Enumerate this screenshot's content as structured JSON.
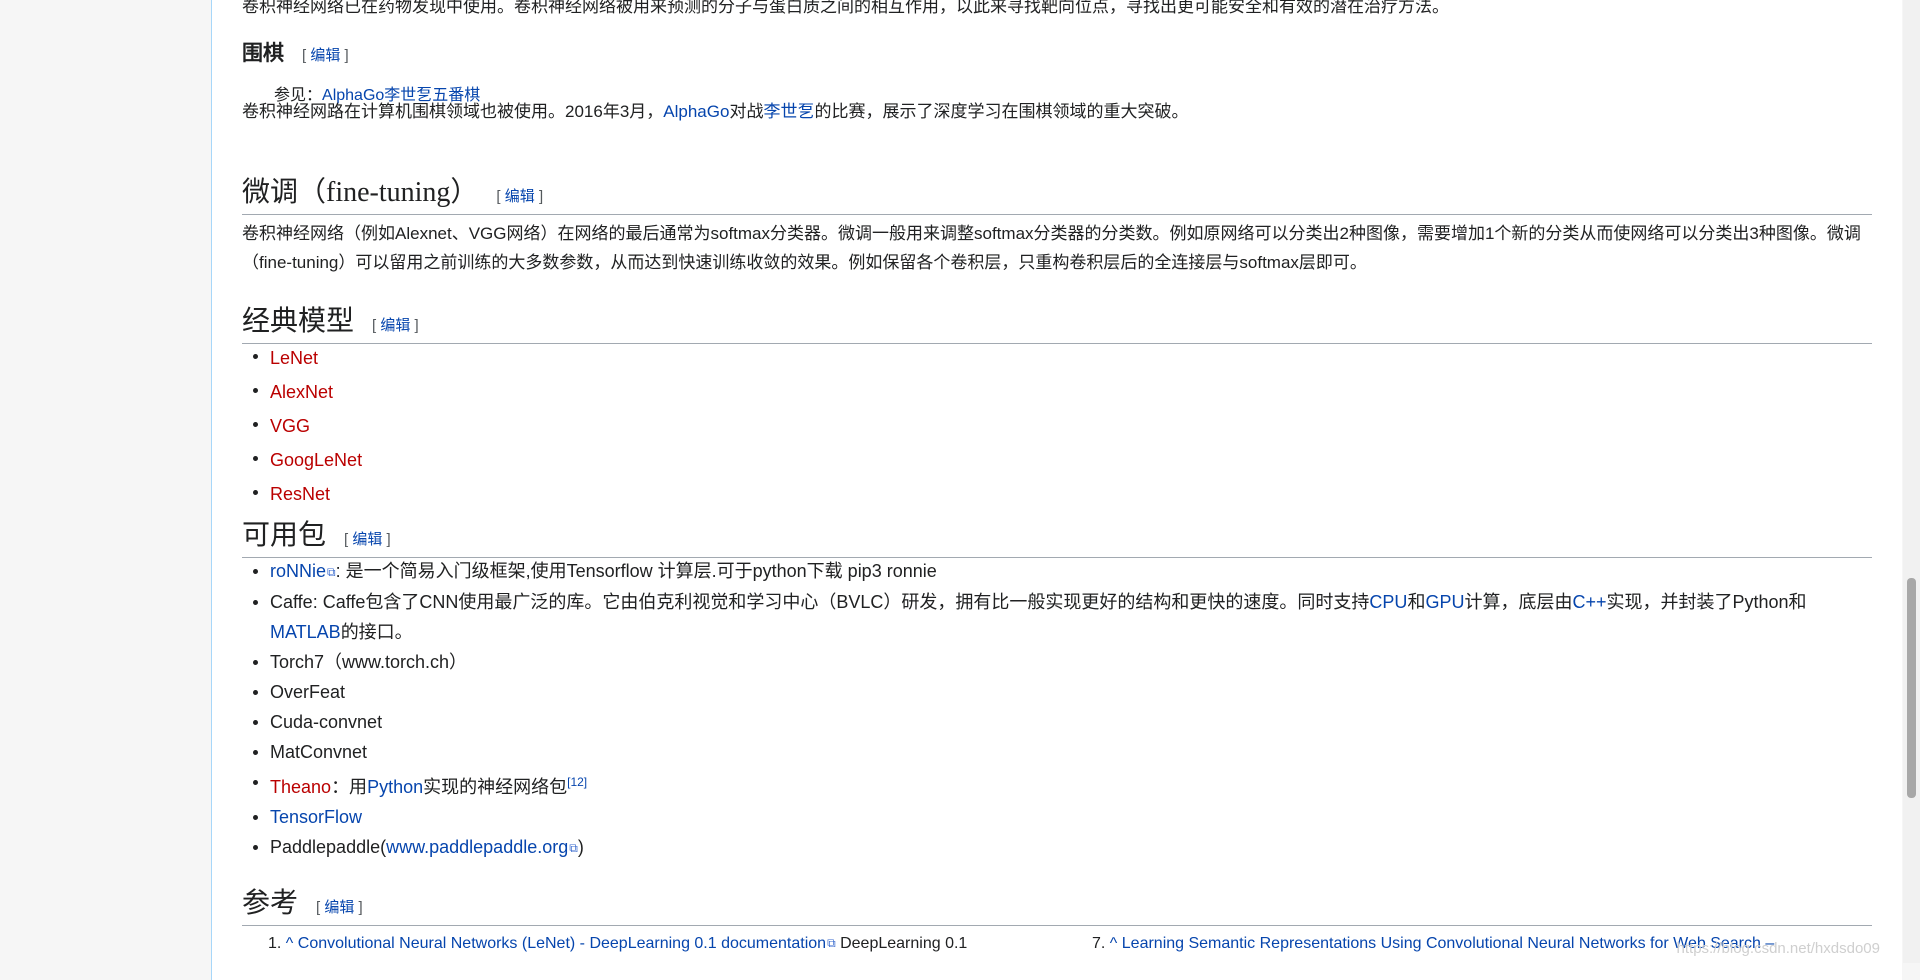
{
  "clipped_text": "卷积神经网络已在药物发现中使用。卷积神经网络被用来预测的分子与蛋白质之间的相互作用，以此来寻找靶向位点，寻找出更可能安全和有效的潜在治疗方法。",
  "edit_label": "编辑",
  "go_section": {
    "heading": "围棋",
    "hatnote_prefix": "参见：",
    "hatnote_link": "AlphaGo李世乭五番棋",
    "para": {
      "t1": "卷积神经网路在计算机围棋领域也被使用。2016年3月，",
      "link1": "AlphaGo",
      "t2": "对战",
      "link2": "李世乭",
      "t3": "的比赛，展示了深度学习在围棋领域的重大突破。"
    }
  },
  "finetune_section": {
    "heading": "微调（fine-tuning）",
    "para": "卷积神经网络（例如Alexnet、VGG网络）在网络的最后通常为softmax分类器。微调一般用来调整softmax分类器的分类数。例如原网络可以分类出2种图像，需要增加1个新的分类从而使网络可以分类出3种图像。微调（fine-tuning）可以留用之前训练的大多数参数，从而达到快速训练收敛的效果。例如保留各个卷积层，只重构卷积层后的全连接层与softmax层即可。"
  },
  "models_section": {
    "heading": "经典模型",
    "items": [
      "LeNet",
      "AlexNet",
      "VGG",
      "GoogLeNet",
      "ResNet"
    ]
  },
  "packages_section": {
    "heading": "可用包",
    "ronnie": {
      "link": "roNNie",
      "text": ": 是一个简易入门级框架,使用Tensorflow 计算层.可于python下载 pip3 ronnie"
    },
    "caffe": {
      "t1": "Caffe: Caffe包含了CNN使用最广泛的库。它由伯克利视觉和学习中心（BVLC）研发，拥有比一般实现更好的结构和更快的速度。同时支持",
      "cpu": "CPU",
      "and": "和",
      "gpu": "GPU",
      "t2": "计算，底层由",
      "cpp": "C++",
      "t3": "实现，并封装了Python和",
      "matlab": "MATLAB",
      "t4": "的接口。"
    },
    "torch": "Torch7（www.torch.ch）",
    "overfeat": "OverFeat",
    "cuda": "Cuda-convnet",
    "matconvnet": "MatConvnet",
    "theano": {
      "link": "Theano",
      "t1": "：用",
      "python": "Python",
      "t2": "实现的神经网络包",
      "sup": "[12]"
    },
    "tensorflow": "TensorFlow",
    "paddle": {
      "t1": "Paddlepaddle(",
      "link": "www.paddlepaddle.org",
      "t2": ")"
    }
  },
  "refs_section": {
    "heading": "参考",
    "ref1": {
      "num": "1.",
      "caret": "^",
      "link": "Convolutional Neural Networks (LeNet) - DeepLearning 0.1 documentation",
      "tail": "DeepLearning 0.1"
    },
    "ref7": {
      "num": "7.",
      "caret": "^",
      "link": "Learning Semantic Representations Using Convolutional Neural Networks for Web Search –"
    }
  },
  "watermark": "https://blog.csdn.net/hxdsdo09"
}
